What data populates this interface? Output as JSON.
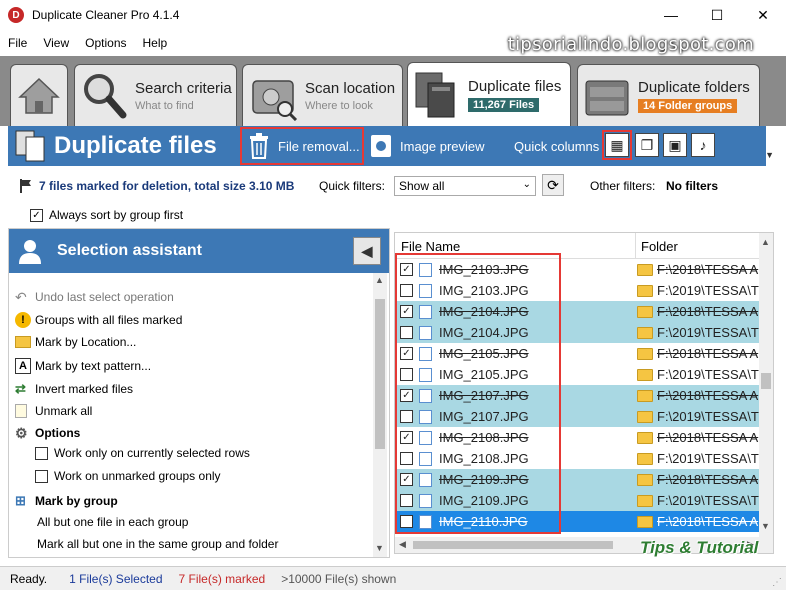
{
  "window": {
    "title": "Duplicate Cleaner Pro 4.1.4",
    "min": "—",
    "max": "☐",
    "close": "✕"
  },
  "menu": [
    "File",
    "View",
    "Options",
    "Help"
  ],
  "watermark": "tipsorialindo.blogspot.com",
  "tabs": [
    {
      "title": "Search criteria",
      "sub": "What to find"
    },
    {
      "title": "Scan location",
      "sub": "Where to look"
    },
    {
      "title": "Duplicate files",
      "badge": "11,267 Files"
    },
    {
      "title": "Duplicate folders",
      "badge": "14 Folder groups"
    }
  ],
  "header": {
    "title": "Duplicate files",
    "file_removal": "File removal...",
    "image_preview": "Image preview",
    "quick_columns": "Quick columns"
  },
  "info": {
    "marked_text": "7 files marked for deletion, total size 3.10 MB",
    "quick_filters_label": "Quick filters:",
    "quick_filters_value": "Show all",
    "other_filters_label": "Other filters:",
    "other_filters_value": "No filters",
    "always_sort": "Always sort by group first"
  },
  "selection_assistant": {
    "title": "Selection assistant",
    "items": [
      "Undo last select operation",
      "Groups with all files marked",
      "Mark by Location...",
      "Mark by text pattern...",
      "Invert marked files",
      "Unmark all",
      "Options",
      "Work only on currently selected rows",
      "Work on unmarked groups only",
      "Mark by group",
      "All but one file in each group",
      "Mark all but one in the same group and folder"
    ]
  },
  "table": {
    "columns": [
      "File Name",
      "Folder"
    ],
    "rows": [
      {
        "name": "IMG_2103.JPG",
        "folder": "F:\\2018\\TESSA A",
        "checked": true
      },
      {
        "name": "IMG_2103.JPG",
        "folder": "F:\\2019\\TESSA\\T",
        "checked": false
      },
      {
        "name": "IMG_2104.JPG",
        "folder": "F:\\2018\\TESSA A",
        "checked": true
      },
      {
        "name": "IMG_2104.JPG",
        "folder": "F:\\2019\\TESSA\\T",
        "checked": false
      },
      {
        "name": "IMG_2105.JPG",
        "folder": "F:\\2018\\TESSA A",
        "checked": true
      },
      {
        "name": "IMG_2105.JPG",
        "folder": "F:\\2019\\TESSA\\T",
        "checked": false
      },
      {
        "name": "IMG_2107.JPG",
        "folder": "F:\\2018\\TESSA A",
        "checked": true
      },
      {
        "name": "IMG_2107.JPG",
        "folder": "F:\\2019\\TESSA\\T",
        "checked": false
      },
      {
        "name": "IMG_2108.JPG",
        "folder": "F:\\2018\\TESSA A",
        "checked": true
      },
      {
        "name": "IMG_2108.JPG",
        "folder": "F:\\2019\\TESSA\\T",
        "checked": false
      },
      {
        "name": "IMG_2109.JPG",
        "folder": "F:\\2018\\TESSA A",
        "checked": true
      },
      {
        "name": "IMG_2109.JPG",
        "folder": "F:\\2019\\TESSA\\T",
        "checked": false
      },
      {
        "name": "IMG_2110.JPG",
        "folder": "F:\\2018\\TESSA A",
        "checked": true
      }
    ]
  },
  "tips_logo": "Tips & Tutorial",
  "status": {
    "ready": "Ready.",
    "selected": "1 File(s) Selected",
    "marked": "7 File(s) marked",
    "shown": ">10000 File(s) shown"
  },
  "colors": {
    "accent": "#3d78b5",
    "alt_row": "#a9d8e3",
    "selected_row": "#1e88e5",
    "highlight_box": "#e53935"
  }
}
